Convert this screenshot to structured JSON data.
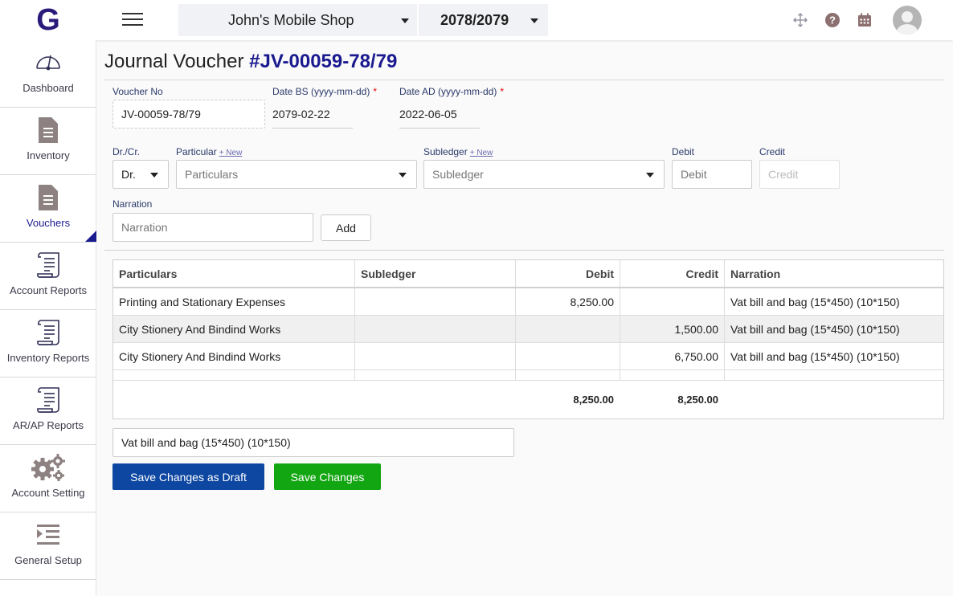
{
  "topbar": {
    "logo_letter": "G",
    "shop_name": "John's Mobile Shop",
    "fiscal_year": "2078/2079",
    "icons": [
      "move-icon",
      "help-icon",
      "calendar-icon",
      "avatar"
    ]
  },
  "sidebar": {
    "items": [
      {
        "label": "Dashboard",
        "icon": "dashboard-icon"
      },
      {
        "label": "Inventory",
        "icon": "document-icon"
      },
      {
        "label": "Vouchers",
        "icon": "document-icon",
        "active": true
      },
      {
        "label": "Account Reports",
        "icon": "scroll-icon"
      },
      {
        "label": "Inventory Reports",
        "icon": "scroll-icon"
      },
      {
        "label": "AR/AP Reports",
        "icon": "scroll-icon"
      },
      {
        "label": "Account Setting",
        "icon": "gears-icon"
      },
      {
        "label": "General Setup",
        "icon": "indent-list-icon"
      }
    ]
  },
  "page": {
    "title_prefix": "Journal Voucher",
    "voucher_ref": "#JV-00059-78/79"
  },
  "form": {
    "voucher_no_label": "Voucher No",
    "voucher_no_value": "JV-00059-78/79",
    "date_bs_label": "Date BS (yyyy-mm-dd)",
    "date_bs_value": "2079-02-22",
    "date_ad_label": "Date AD (yyyy-mm-dd)",
    "date_ad_value": "2022-06-05",
    "required_mark": "*",
    "drcr_label": "Dr./Cr.",
    "drcr_value": "Dr.",
    "particular_label": "Particular",
    "particular_placeholder": "Particulars",
    "subledger_label": "Subledger",
    "subledger_placeholder": "Subledger",
    "new_link": "+ New",
    "debit_label": "Debit",
    "debit_placeholder": "Debit",
    "credit_label": "Credit",
    "credit_placeholder": "Credit",
    "narration_label": "Narration",
    "narration_placeholder": "Narration",
    "add_button": "Add"
  },
  "table": {
    "headers": [
      "Particulars",
      "Subledger",
      "Debit",
      "Credit",
      "Narration"
    ],
    "rows": [
      {
        "particulars": "Printing and Stationary Expenses",
        "subledger": "",
        "debit": "8,250.00",
        "credit": "",
        "narration": "Vat bill and bag (15*450) (10*150)"
      },
      {
        "particulars": "City Stionery And Bindind Works",
        "subledger": "",
        "debit": "",
        "credit": "1,500.00",
        "narration": "Vat bill and bag (15*450) (10*150)"
      },
      {
        "particulars": "City Stionery And Bindind Works",
        "subledger": "",
        "debit": "",
        "credit": "6,750.00",
        "narration": "Vat bill and bag (15*450) (10*150)"
      }
    ],
    "total_debit": "8,250.00",
    "total_credit": "8,250.00"
  },
  "footer": {
    "narration_value": "Vat bill and bag (15*450) (10*150)",
    "save_draft_button": "Save Changes as Draft",
    "save_button": "Save Changes"
  },
  "colors": {
    "brand": "#2a1b7a",
    "accent": "#1a1a8f",
    "draft_button": "#0d47a1",
    "save_button": "#13a613"
  }
}
